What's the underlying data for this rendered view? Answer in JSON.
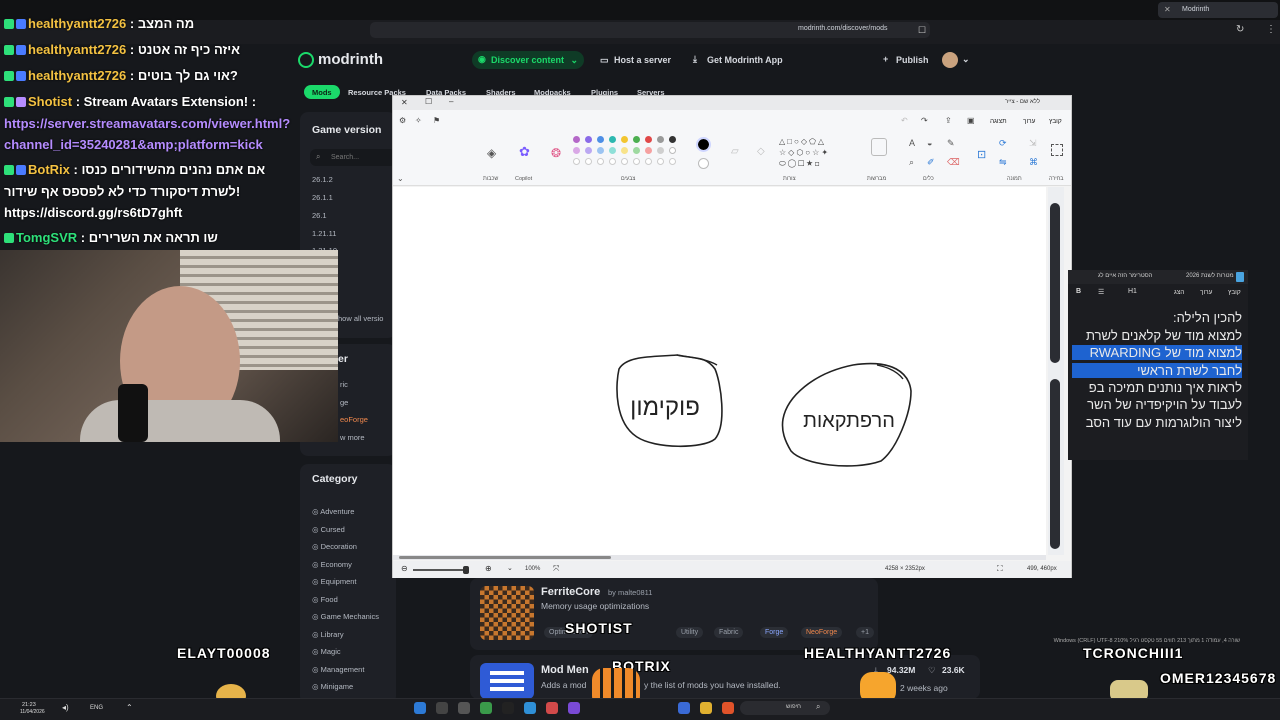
{
  "browser": {
    "tab_title": "Modrinth",
    "url": "modrinth.com/discover/mods"
  },
  "modrinth": {
    "brand": "modrinth",
    "nav": {
      "discover": "Discover content",
      "host": "Host a server",
      "app": "Get Modrinth App",
      "publish": "Publish"
    },
    "content_tabs": [
      "Mods",
      "Resource Packs",
      "Data Packs",
      "Shaders",
      "Modpacks",
      "Plugins",
      "Servers"
    ],
    "sidebar": {
      "game_version_title": "Game version",
      "search_placeholder": "Search...",
      "versions": [
        "26.1.2",
        "26.1.1",
        "26.1",
        "1.21.11",
        "1.21.10"
      ],
      "show_all": "how all versio",
      "loader_title": "er",
      "loaders": [
        "ric",
        "ge",
        "eoForge"
      ],
      "show_more": "w more",
      "category_title": "Category",
      "categories": [
        "Adventure",
        "Cursed",
        "Decoration",
        "Economy",
        "Equipment",
        "Food",
        "Game Mechanics",
        "Library",
        "Magic",
        "Management",
        "Minigame"
      ]
    },
    "results": [
      {
        "title": "FerriteCore",
        "author": "by malte0811",
        "description": "Memory usage optimizations",
        "tags": [
          "Optimization",
          "Utility",
          "Fabric",
          "Forge",
          "NeoForge",
          "+1"
        ]
      },
      {
        "title": "Mod Men",
        "description": "Adds a mod",
        "description_tail": "y the list of mods you have installed.",
        "downloads": "94.32M",
        "follows": "23.6K",
        "updated": "2 weeks ago"
      }
    ]
  },
  "chat": [
    {
      "user": "healthyantt2726",
      "text": ": מה המצב",
      "user_color": "gold"
    },
    {
      "user": "healthyantt2726",
      "text": ": איזה כיף זה אטנט",
      "user_color": "gold"
    },
    {
      "user": "healthyantt2726",
      "text": ": אוי גם לך בוטים?",
      "user_color": "gold"
    },
    {
      "user": "Shotist",
      "text": ": Stream Avatars Extension! :",
      "user_color": "gold"
    },
    {
      "user": "BotRix",
      "text": ": אם אתם נהנים מהשידורים כנסו",
      "user_color": "gold"
    },
    {
      "user": "TomgSVR",
      "text": ": שו תראה את השרירים",
      "user_color": "green"
    }
  ],
  "chat_links": {
    "streamavatars_1": "https://server.streamavatars.com/viewer.html?",
    "streamavatars_2": "channel_id=35240281&amp;platform=kick",
    "botrix_cont": "לשרת דיסקורד כדי לא לפספס אף שידור!",
    "discord": "https://discord.gg/rs6tD7ghft"
  },
  "paint": {
    "title": "ללא שם - צייר",
    "menu": [
      "קובץ",
      "ערוך",
      "תצוגה"
    ],
    "group_labels": [
      "בחירה",
      "תמונה",
      "כלים",
      "מברשות",
      "צורות",
      "צבעים",
      "Copilot",
      "שכבות"
    ],
    "zoom": "100%",
    "dimensions": "4258 × 2352px",
    "cursor": "499, 460px",
    "drawing_left": "פוקימון",
    "drawing_right": "הרפתקאות"
  },
  "document": {
    "tab1": "מטרות לשנת 2026",
    "tab2": "הסטרימר הזה איים לג",
    "menu": [
      "קובץ",
      "ערוך",
      "הצג"
    ],
    "heading": "להכין הלילה:",
    "lines": [
      "למצוא מוד של קלאנים לשרת",
      "למצוא מוד של RWARDING",
      "לחבר לשרת הראשי",
      "לראות איך נותנים תמיכה בפ",
      "לעבוד על הויקיפדיה של השר",
      "ליצור הולוגרמות עם עוד הסב"
    ],
    "status": "שורה 4, עמודה 1   מתוך 213 תווים   55   טקסט רגיל   210%   Windows (CRLF)   UTF-8"
  },
  "avatars": [
    "ELAYT00008",
    "SHOTIST",
    "BOTRIX",
    "HEALTHYANTT2726",
    "TCRONCHIII1",
    "OMER12345678"
  ],
  "taskbar": {
    "time": "21:23",
    "date": "11/04/2026",
    "lang": "ENG",
    "search": "חיפוש"
  }
}
